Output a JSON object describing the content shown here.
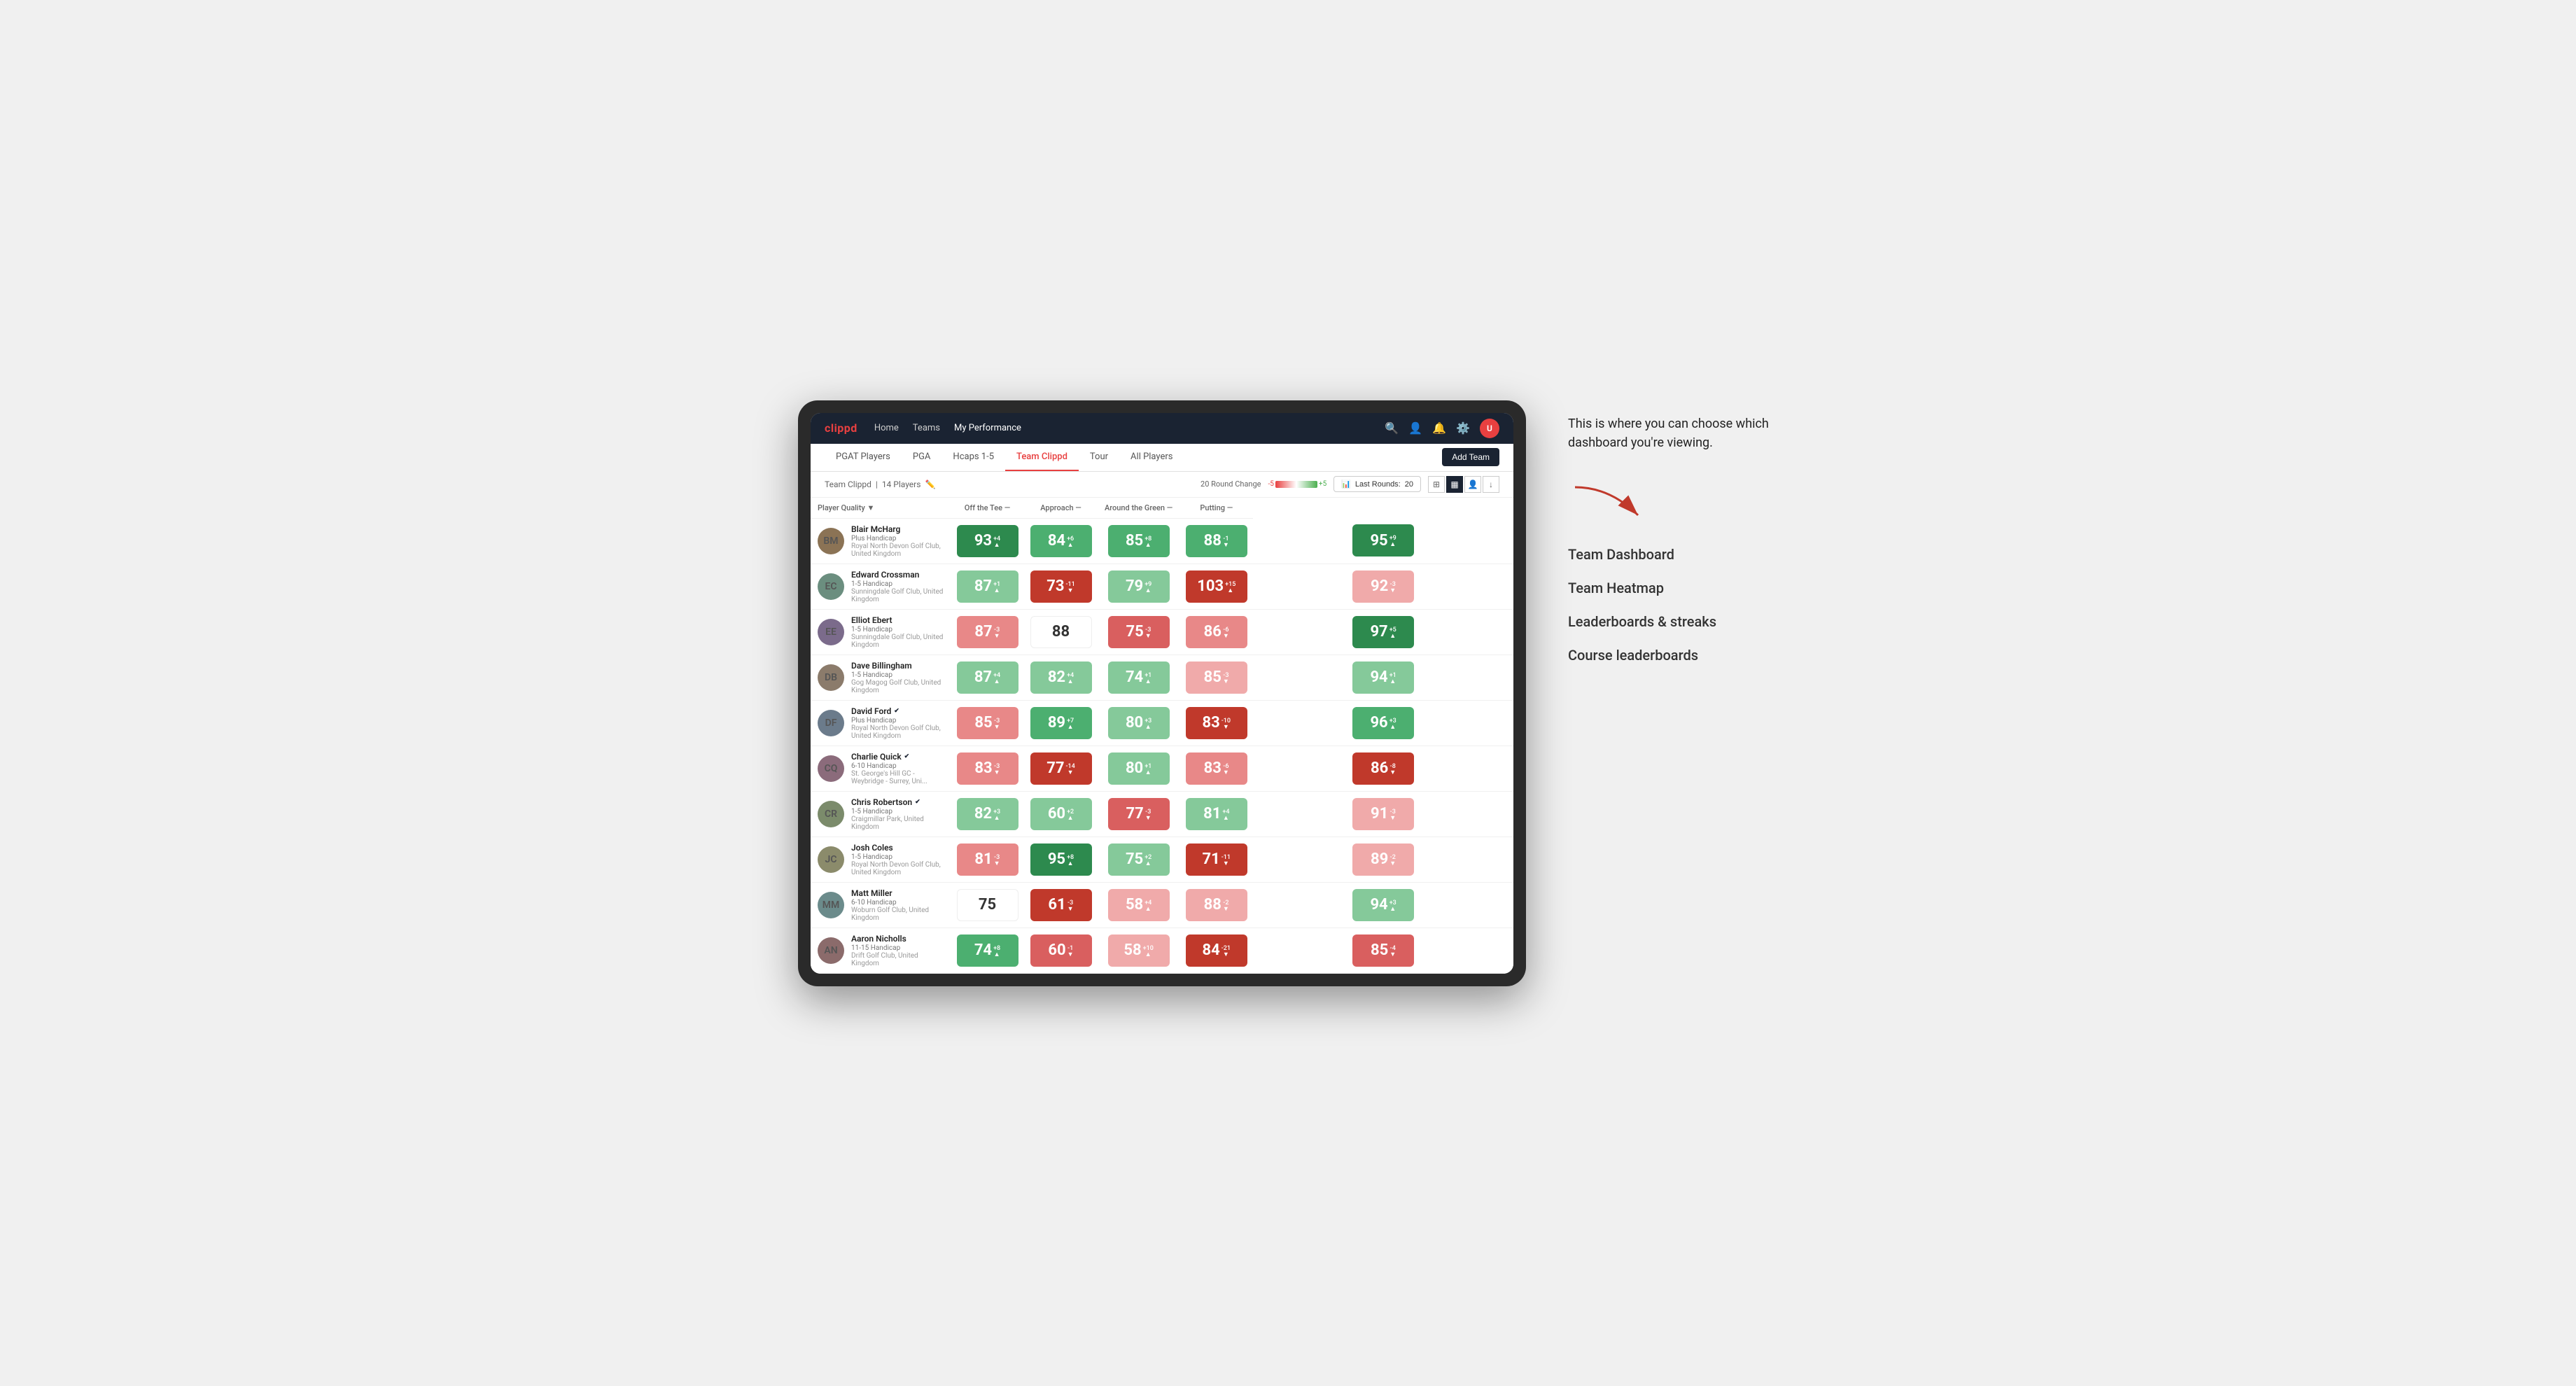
{
  "annotation": {
    "callout": "This is where you can choose which dashboard you're viewing.",
    "items": [
      "Team Dashboard",
      "Team Heatmap",
      "Leaderboards & streaks",
      "Course leaderboards"
    ]
  },
  "nav": {
    "logo": "clippd",
    "links": [
      "Home",
      "Teams",
      "My Performance"
    ],
    "active_link": "My Performance"
  },
  "tabs": {
    "items": [
      "PGAT Players",
      "PGA",
      "Hcaps 1-5",
      "Team Clippd",
      "Tour",
      "All Players"
    ],
    "active": "Team Clippd",
    "add_button": "Add Team"
  },
  "subbar": {
    "team_name": "Team Clippd",
    "player_count": "14 Players",
    "round_change_label": "20 Round Change",
    "heat_neg": "-5",
    "heat_pos": "+5",
    "last_rounds_label": "Last Rounds:",
    "last_rounds_value": "20"
  },
  "table": {
    "columns": [
      {
        "label": "Player Quality ▼",
        "key": "player_quality"
      },
      {
        "label": "Off the Tee ▼",
        "key": "off_tee"
      },
      {
        "label": "Approach —",
        "key": "approach"
      },
      {
        "label": "Around the Green —",
        "key": "around_green"
      },
      {
        "label": "Putting —",
        "key": "putting"
      }
    ],
    "rows": [
      {
        "name": "Blair McHarg",
        "handicap": "Plus Handicap",
        "club": "Royal North Devon Golf Club, United Kingdom",
        "avatar_class": "av1",
        "avatar_initials": "BM",
        "verified": false,
        "scores": [
          {
            "value": 93,
            "change": "+4",
            "dir": "up",
            "bg": "bg-green-dark"
          },
          {
            "value": 84,
            "change": "+6",
            "dir": "up",
            "bg": "bg-green-med"
          },
          {
            "value": 85,
            "change": "+8",
            "dir": "up",
            "bg": "bg-green-med"
          },
          {
            "value": 88,
            "change": "-1",
            "dir": "down",
            "bg": "bg-green-med"
          },
          {
            "value": 95,
            "change": "+9",
            "dir": "up",
            "bg": "bg-green-dark"
          }
        ]
      },
      {
        "name": "Edward Crossman",
        "handicap": "1-5 Handicap",
        "club": "Sunningdale Golf Club, United Kingdom",
        "avatar_class": "av2",
        "avatar_initials": "EC",
        "verified": false,
        "scores": [
          {
            "value": 87,
            "change": "+1",
            "dir": "up",
            "bg": "bg-green-light"
          },
          {
            "value": 73,
            "change": "-11",
            "dir": "down",
            "bg": "bg-red-dark"
          },
          {
            "value": 79,
            "change": "+9",
            "dir": "up",
            "bg": "bg-green-light"
          },
          {
            "value": 103,
            "change": "+15",
            "dir": "up",
            "bg": "bg-red-dark"
          },
          {
            "value": 92,
            "change": "-3",
            "dir": "down",
            "bg": "bg-red-pale"
          }
        ]
      },
      {
        "name": "Elliot Ebert",
        "handicap": "1-5 Handicap",
        "club": "Sunningdale Golf Club, United Kingdom",
        "avatar_class": "av3",
        "avatar_initials": "EE",
        "verified": false,
        "scores": [
          {
            "value": 87,
            "change": "-3",
            "dir": "down",
            "bg": "bg-red-light"
          },
          {
            "value": 88,
            "change": "",
            "dir": "",
            "bg": "bg-white"
          },
          {
            "value": 75,
            "change": "-3",
            "dir": "down",
            "bg": "bg-red-med"
          },
          {
            "value": 86,
            "change": "-6",
            "dir": "down",
            "bg": "bg-red-light"
          },
          {
            "value": 97,
            "change": "+5",
            "dir": "up",
            "bg": "bg-green-dark"
          }
        ]
      },
      {
        "name": "Dave Billingham",
        "handicap": "1-5 Handicap",
        "club": "Gog Magog Golf Club, United Kingdom",
        "avatar_class": "av4",
        "avatar_initials": "DB",
        "verified": false,
        "scores": [
          {
            "value": 87,
            "change": "+4",
            "dir": "up",
            "bg": "bg-green-light"
          },
          {
            "value": 82,
            "change": "+4",
            "dir": "up",
            "bg": "bg-green-light"
          },
          {
            "value": 74,
            "change": "+1",
            "dir": "up",
            "bg": "bg-green-light"
          },
          {
            "value": 85,
            "change": "-3",
            "dir": "down",
            "bg": "bg-red-pale"
          },
          {
            "value": 94,
            "change": "+1",
            "dir": "up",
            "bg": "bg-green-light"
          }
        ]
      },
      {
        "name": "David Ford",
        "handicap": "Plus Handicap",
        "club": "Royal North Devon Golf Club, United Kingdom",
        "avatar_class": "av5",
        "avatar_initials": "DF",
        "verified": true,
        "scores": [
          {
            "value": 85,
            "change": "-3",
            "dir": "down",
            "bg": "bg-red-light"
          },
          {
            "value": 89,
            "change": "+7",
            "dir": "up",
            "bg": "bg-green-med"
          },
          {
            "value": 80,
            "change": "+3",
            "dir": "up",
            "bg": "bg-green-light"
          },
          {
            "value": 83,
            "change": "-10",
            "dir": "down",
            "bg": "bg-red-dark"
          },
          {
            "value": 96,
            "change": "+3",
            "dir": "up",
            "bg": "bg-green-med"
          }
        ]
      },
      {
        "name": "Charlie Quick",
        "handicap": "6-10 Handicap",
        "club": "St. George's Hill GC - Weybridge - Surrey, Uni...",
        "avatar_class": "av6",
        "avatar_initials": "CQ",
        "verified": true,
        "scores": [
          {
            "value": 83,
            "change": "-3",
            "dir": "down",
            "bg": "bg-red-light"
          },
          {
            "value": 77,
            "change": "-14",
            "dir": "down",
            "bg": "bg-red-dark"
          },
          {
            "value": 80,
            "change": "+1",
            "dir": "up",
            "bg": "bg-green-light"
          },
          {
            "value": 83,
            "change": "-6",
            "dir": "down",
            "bg": "bg-red-light"
          },
          {
            "value": 86,
            "change": "-8",
            "dir": "down",
            "bg": "bg-red-dark"
          }
        ]
      },
      {
        "name": "Chris Robertson",
        "handicap": "1-5 Handicap",
        "club": "Craigmillar Park, United Kingdom",
        "avatar_class": "av7",
        "avatar_initials": "CR",
        "verified": true,
        "scores": [
          {
            "value": 82,
            "change": "+3",
            "dir": "up",
            "bg": "bg-green-light"
          },
          {
            "value": 60,
            "change": "+2",
            "dir": "up",
            "bg": "bg-green-light"
          },
          {
            "value": 77,
            "change": "-3",
            "dir": "down",
            "bg": "bg-red-med"
          },
          {
            "value": 81,
            "change": "+4",
            "dir": "up",
            "bg": "bg-green-light"
          },
          {
            "value": 91,
            "change": "-3",
            "dir": "down",
            "bg": "bg-red-pale"
          }
        ]
      },
      {
        "name": "Josh Coles",
        "handicap": "1-5 Handicap",
        "club": "Royal North Devon Golf Club, United Kingdom",
        "avatar_class": "av8",
        "avatar_initials": "JC",
        "verified": false,
        "scores": [
          {
            "value": 81,
            "change": "-3",
            "dir": "down",
            "bg": "bg-red-light"
          },
          {
            "value": 95,
            "change": "+8",
            "dir": "up",
            "bg": "bg-green-dark"
          },
          {
            "value": 75,
            "change": "+2",
            "dir": "up",
            "bg": "bg-green-light"
          },
          {
            "value": 71,
            "change": "-11",
            "dir": "down",
            "bg": "bg-red-dark"
          },
          {
            "value": 89,
            "change": "-2",
            "dir": "down",
            "bg": "bg-red-pale"
          }
        ]
      },
      {
        "name": "Matt Miller",
        "handicap": "6-10 Handicap",
        "club": "Woburn Golf Club, United Kingdom",
        "avatar_class": "av9",
        "avatar_initials": "MM",
        "verified": false,
        "scores": [
          {
            "value": 75,
            "change": "",
            "dir": "",
            "bg": "bg-white"
          },
          {
            "value": 61,
            "change": "-3",
            "dir": "down",
            "bg": "bg-red-dark"
          },
          {
            "value": 58,
            "change": "+4",
            "dir": "up",
            "bg": "bg-red-pale"
          },
          {
            "value": 88,
            "change": "-2",
            "dir": "down",
            "bg": "bg-red-pale"
          },
          {
            "value": 94,
            "change": "+3",
            "dir": "up",
            "bg": "bg-green-light"
          }
        ]
      },
      {
        "name": "Aaron Nicholls",
        "handicap": "11-15 Handicap",
        "club": "Drift Golf Club, United Kingdom",
        "avatar_class": "av10",
        "avatar_initials": "AN",
        "verified": false,
        "scores": [
          {
            "value": 74,
            "change": "+8",
            "dir": "up",
            "bg": "bg-green-med"
          },
          {
            "value": 60,
            "change": "-1",
            "dir": "down",
            "bg": "bg-red-med"
          },
          {
            "value": 58,
            "change": "+10",
            "dir": "up",
            "bg": "bg-red-pale"
          },
          {
            "value": 84,
            "change": "-21",
            "dir": "down",
            "bg": "bg-red-dark"
          },
          {
            "value": 85,
            "change": "-4",
            "dir": "down",
            "bg": "bg-red-med"
          }
        ]
      }
    ]
  }
}
